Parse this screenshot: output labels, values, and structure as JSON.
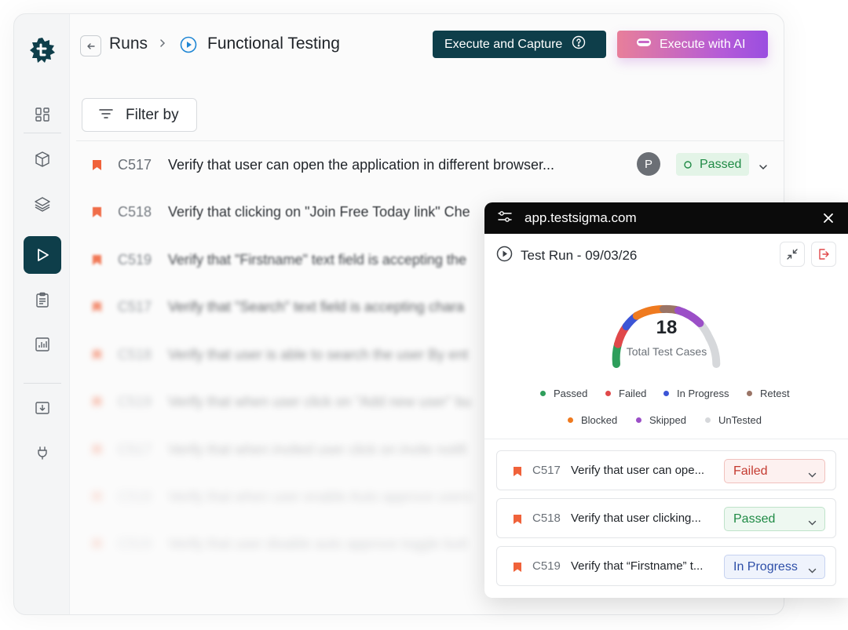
{
  "breadcrumb": {
    "root": "Runs",
    "current": "Functional Testing"
  },
  "toolbar": {
    "capture_label": "Execute and Capture",
    "ai_label": "Execute with AI"
  },
  "filter": {
    "label": "Filter by"
  },
  "tests": [
    {
      "id": "C517",
      "title": "Verify that user can open the application in different browser...",
      "assignee": "P",
      "status": "Passed"
    },
    {
      "id": "C518",
      "title": "Verify that clicking on \"Join Free Today link\" Che"
    },
    {
      "id": "C519",
      "title": "Verify that \"Firstname\" text field is accepting the"
    },
    {
      "id": "C517",
      "title": "Verify that \"Search\" text field is accepting chara"
    },
    {
      "id": "C518",
      "title": "Verify that user is able to search the user By ent"
    },
    {
      "id": "C519",
      "title": "Verify that when user click on \"Add new user\" bu"
    },
    {
      "id": "C517",
      "title": "Verify that when invited user click on invite notifi"
    },
    {
      "id": "C518",
      "title": "Verify that when user enable Auto approve users"
    },
    {
      "id": "C519",
      "title": "Verify that user disable auto approve toggle butt"
    }
  ],
  "popup": {
    "url": "app.testsigma.com",
    "run_title": "Test Run - 09/03/26",
    "total": "18",
    "total_label": "Total Test Cases",
    "legend": [
      {
        "label": "Passed",
        "color": "#2e9e5b"
      },
      {
        "label": "Failed",
        "color": "#e0484a"
      },
      {
        "label": "In Progress",
        "color": "#3c55d6"
      },
      {
        "label": "Retest",
        "color": "#9a7466"
      },
      {
        "label": "Blocked",
        "color": "#ef7a1f"
      },
      {
        "label": "Skipped",
        "color": "#9b4fc7"
      },
      {
        "label": "UnTested",
        "color": "#d6d8db"
      }
    ],
    "cases": [
      {
        "id": "C517",
        "title": "Verify that user can ope...",
        "status": "Failed"
      },
      {
        "id": "C518",
        "title": "Verify that user clicking...",
        "status": "Passed"
      },
      {
        "id": "C519",
        "title": "Verify that “Firstname” t...",
        "status": "In Progress"
      }
    ]
  },
  "colors": {
    "primary": "#0e3e4a",
    "flag": "#f0623a",
    "passed": "#1f8a45",
    "failed": "#c43a30",
    "in_progress": "#2d4ea8"
  }
}
